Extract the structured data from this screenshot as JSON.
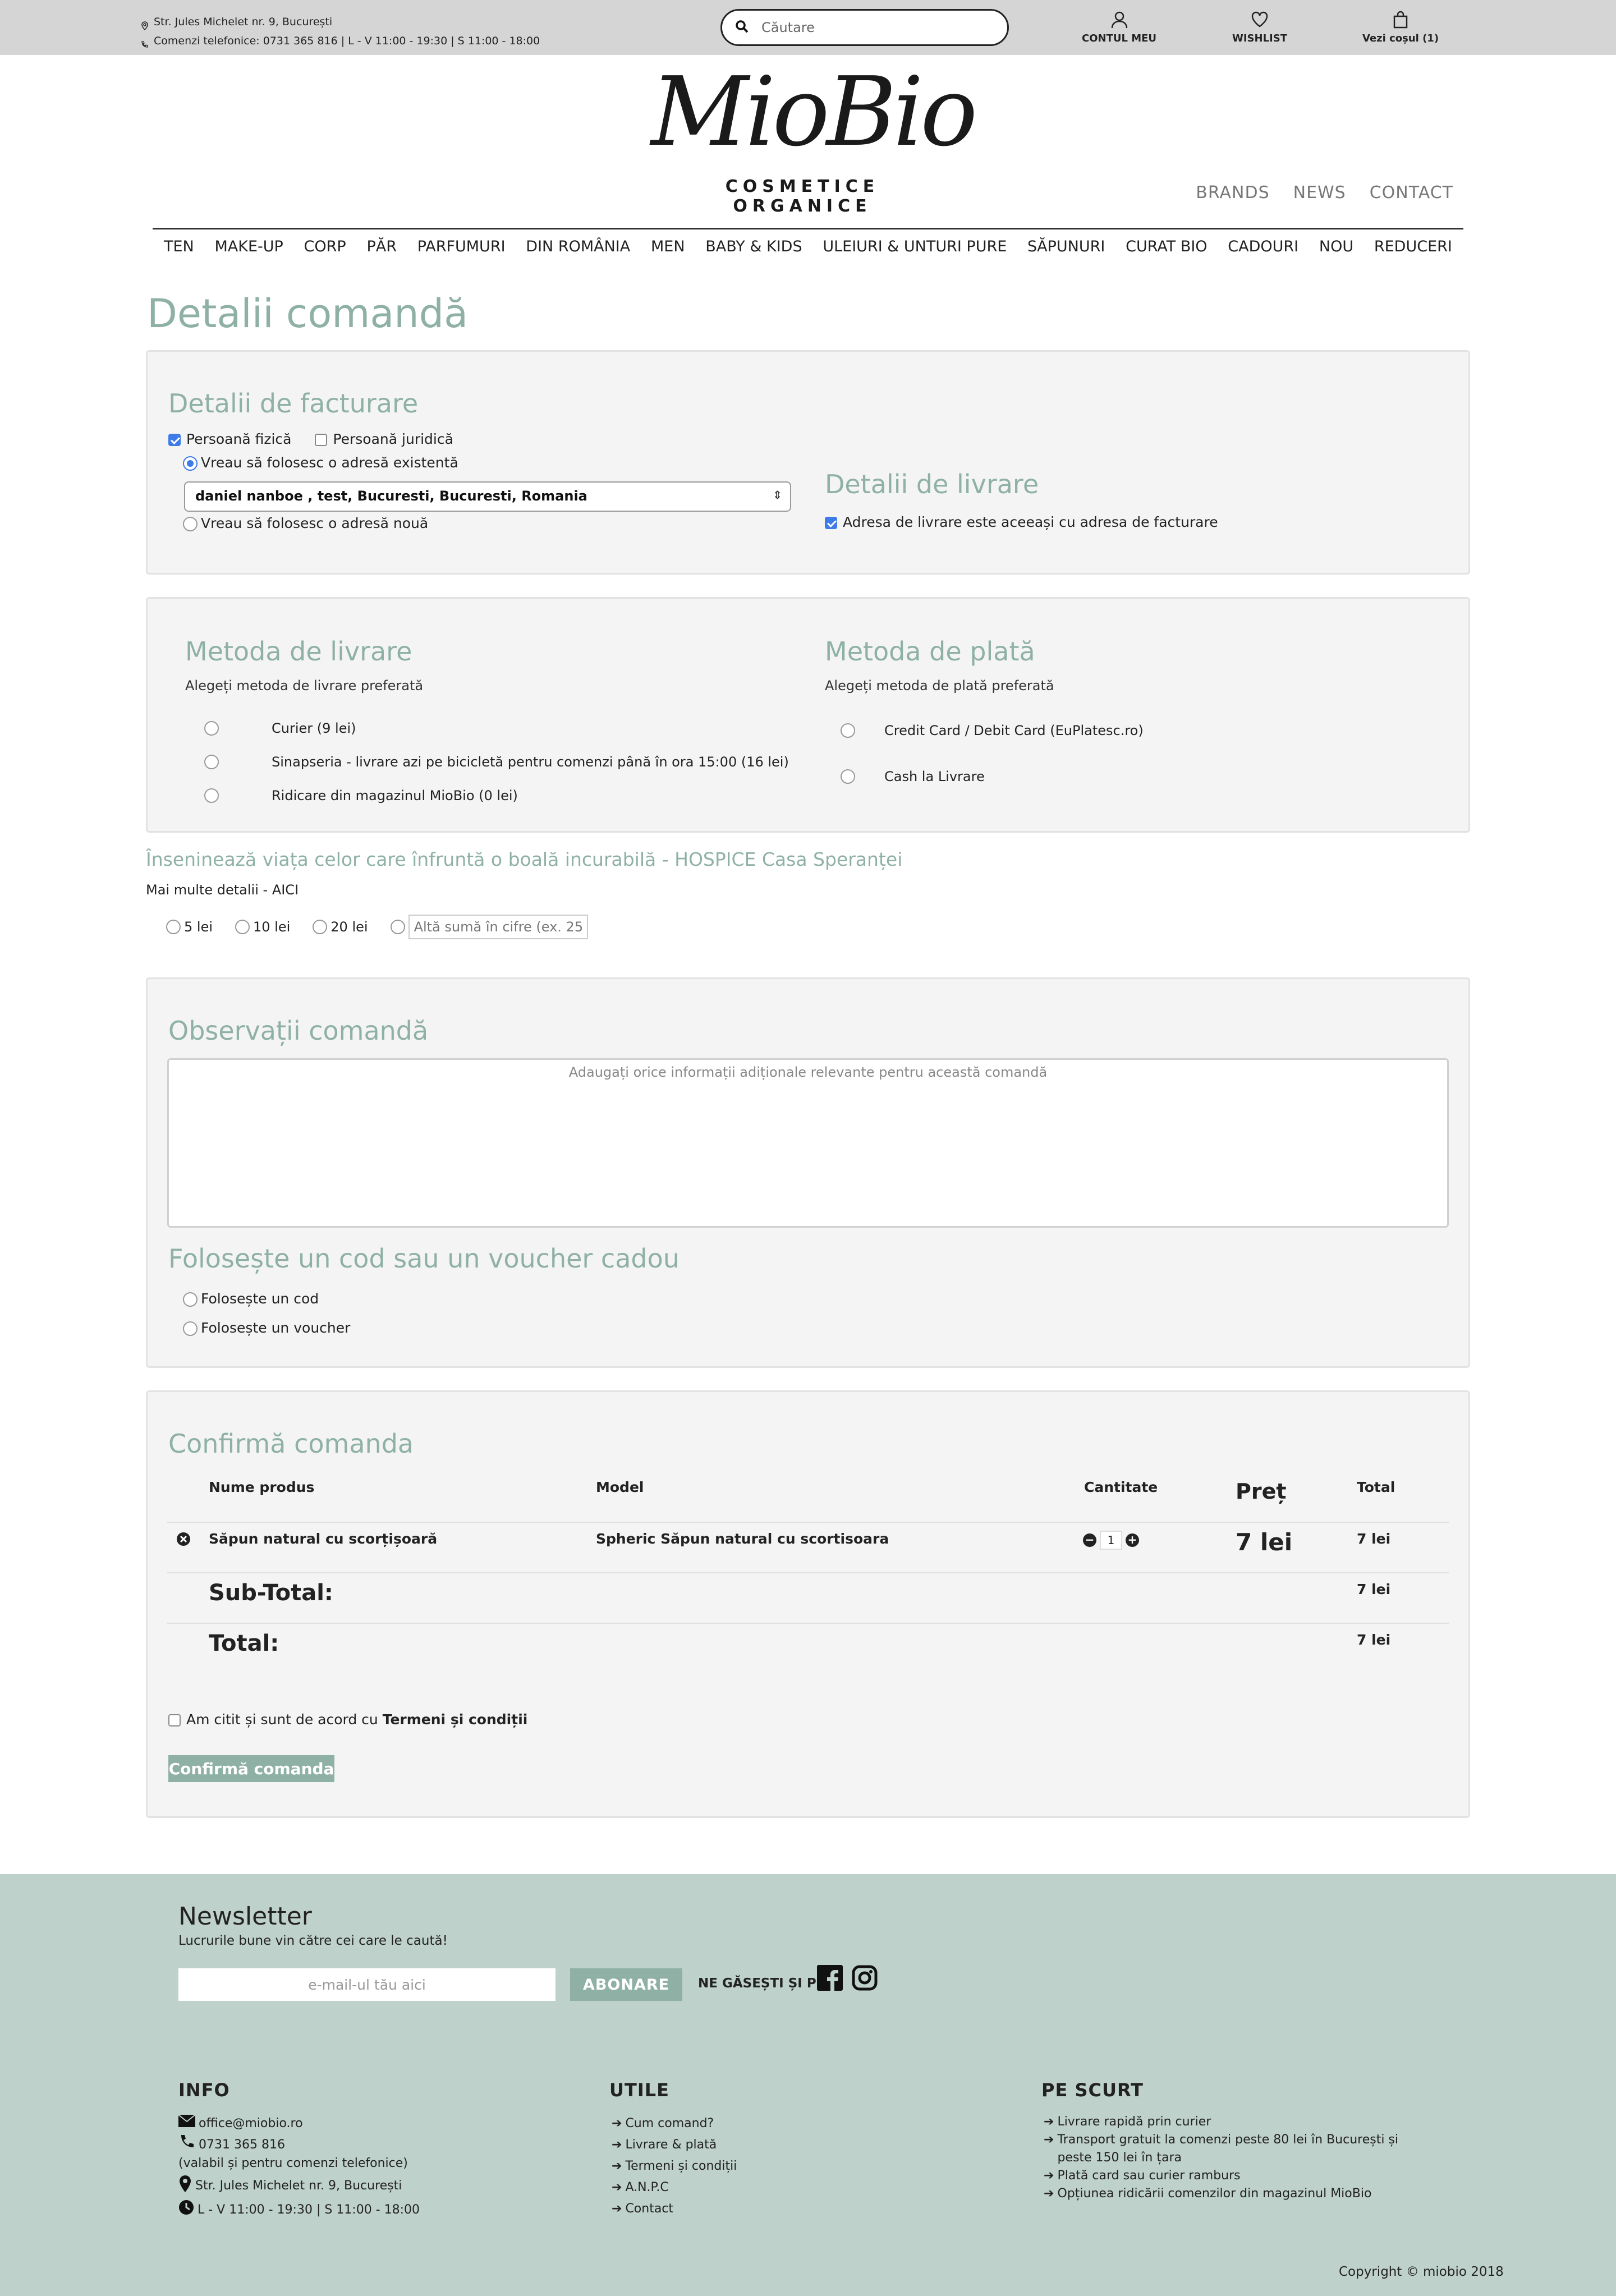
{
  "topbar": {
    "address": "Str. Jules Michelet nr. 9, București",
    "phone": "Comenzi telefonice: 0731 365 816 | L - V 11:00 - 19:30 | S 11:00 - 18:00",
    "search_placeholder": "Căutare",
    "account": "CONTUL MEU",
    "wishlist": "WISHLIST",
    "cart": "Vezi coșul (1)"
  },
  "header": {
    "logo_text": "MioBio",
    "logo_sub": "COSMETICE ORGANICE",
    "links": [
      "BRANDS",
      "NEWS",
      "CONTACT"
    ]
  },
  "nav": [
    "TEN",
    "MAKE-UP",
    "CORP",
    "PĂR",
    "PARFUMURI",
    "DIN ROMÂNIA",
    "MEN",
    "BABY & KIDS",
    "ULEIURI & UNTURI PURE",
    "SĂPUNURI",
    "CURAT BIO",
    "CADOURI",
    "NOU",
    "REDUCERI"
  ],
  "page_title": "Detalii comandă",
  "billing": {
    "title": "Detalii de facturare",
    "person": "Persoană fizică",
    "company": "Persoană juridică",
    "existing": "Vreau să folosesc o adresă existentă",
    "selected_address": "daniel nanboe , test, Bucuresti, Bucuresti, Romania",
    "new_address": "Vreau să folosesc o adresă nouă"
  },
  "shipping_details": {
    "title": "Detalii de livrare",
    "same_address": "Adresa de livrare este aceeași cu adresa de facturare"
  },
  "delivery": {
    "title": "Metoda de livrare",
    "subtitle": "Alegeți metoda de livrare preferată",
    "options": [
      "Curier (9 lei)",
      "Sinapseria - livrare azi pe bicicletă pentru comenzi până în ora 15:00 (16 lei)",
      "Ridicare din magazinul MioBio (0 lei)"
    ]
  },
  "payment": {
    "title": "Metoda de plată",
    "subtitle": "Alegeți metoda de plată preferată",
    "options": [
      "Credit Card / Debit Card (EuPlatesc.ro)",
      "Cash la Livrare"
    ]
  },
  "donation": {
    "title": "Înseninează viața celor care înfruntă o boală incurabilă - HOSPICE Casa Speranței",
    "more": "Mai multe detalii - AICI",
    "options": [
      "5 lei",
      "10 lei",
      "20 lei"
    ],
    "custom_placeholder": "Altă sumă în cifre (ex. 25)"
  },
  "notes": {
    "title": "Observații comandă",
    "placeholder": "Adaugați orice informații adiționale relevante pentru această comandă"
  },
  "voucher": {
    "title": "Folosește un cod sau un voucher cadou",
    "code": "Folosește un cod",
    "voucher": "Folosește un voucher"
  },
  "confirm": {
    "title": "Confirmă comanda",
    "headers": {
      "name": "Nume produs",
      "model": "Model",
      "qty": "Cantitate",
      "price": "Preț",
      "total": "Total"
    },
    "item": {
      "name": "Săpun natural cu scorțișoară",
      "model": "Spheric Săpun natural cu scortisoara",
      "qty": "1",
      "price": "7 lei",
      "total": "7 lei"
    },
    "subtotal_label": "Sub-Total:",
    "subtotal": "7 lei",
    "total_label": "Total:",
    "total": "7 lei",
    "terms_prefix": "Am citit și sunt de acord cu",
    "terms_link": "Termeni și condiții",
    "button": "Confirmă comanda"
  },
  "footer": {
    "newsletter_title": "Newsletter",
    "newsletter_sub": "Lucrurile bune vin către cei care le caută!",
    "email_placeholder": "e-mail-ul tău aici",
    "subscribe": "ABONARE",
    "find_us": "NE GĂSEȘTI ȘI PE",
    "info_title": "INFO",
    "info": {
      "email": "office@miobio.ro",
      "phone": "0731 365 816",
      "phone_note": "(valabil și pentru comenzi telefonice)",
      "address": "Str. Jules Michelet nr. 9, București",
      "hours": "L - V 11:00 - 19:30 | S 11:00 - 18:00"
    },
    "utile_title": "UTILE",
    "utile": [
      "Cum comand?",
      "Livrare & plată",
      "Termeni și condiții",
      "A.N.P.C",
      "Contact"
    ],
    "scurt_title": "PE SCURT",
    "scurt": [
      "Livrare rapidă prin curier",
      "Transport gratuit la comenzi peste 80 lei în București și peste 150 lei în țara",
      "Plată card sau curier ramburs",
      "Opțiunea ridicării comenzilor din magazinul MioBio"
    ],
    "copyright": "Copyright © miobio 2018"
  },
  "colors": {
    "accent": "#8fb1a5",
    "footer_bg": "#bfd1cb",
    "topbar_bg": "#d5d5d5",
    "checkbox": "#3d7be8"
  }
}
